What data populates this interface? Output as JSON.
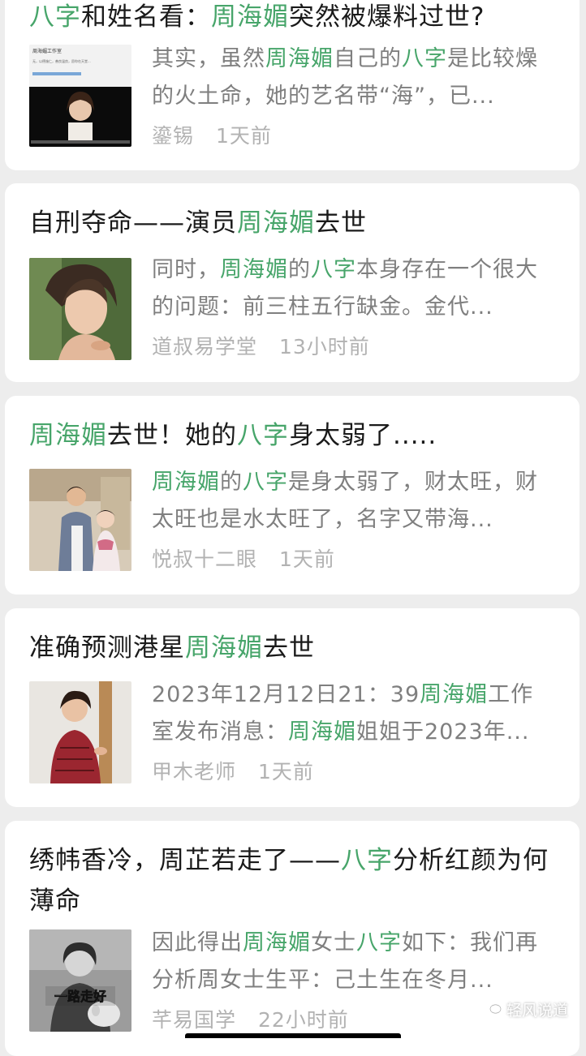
{
  "articles": [
    {
      "title": [
        {
          "t": "八字",
          "hl": true
        },
        {
          "t": "和姓名看：",
          "hl": false
        },
        {
          "t": "周海媚",
          "hl": true
        },
        {
          "t": "突然被爆料过世?",
          "hl": false
        }
      ],
      "snippet": [
        {
          "t": "其实，虽然",
          "hl": false
        },
        {
          "t": "周海媚",
          "hl": true
        },
        {
          "t": "自己的",
          "hl": false
        },
        {
          "t": "八字",
          "hl": true
        },
        {
          "t": "是比较燥的火土命，她的艺名带“海”，已...",
          "hl": false
        }
      ],
      "source": "鎏锡",
      "time": "1天前",
      "thumb": "video-screenshot"
    },
    {
      "title": [
        {
          "t": "自刑夺命——演员",
          "hl": false
        },
        {
          "t": "周海媚",
          "hl": true
        },
        {
          "t": "去世",
          "hl": false
        }
      ],
      "snippet": [
        {
          "t": "同时，",
          "hl": false
        },
        {
          "t": "周海媚",
          "hl": true
        },
        {
          "t": "的",
          "hl": false
        },
        {
          "t": "八字",
          "hl": true
        },
        {
          "t": "本身存在一个很大的问题：前三柱五行缺金。金代...",
          "hl": false
        }
      ],
      "source": "道叔易学堂",
      "time": "13小时前",
      "thumb": "portrait-photo"
    },
    {
      "title": [
        {
          "t": "周海媚",
          "hl": true
        },
        {
          "t": "去世！她的",
          "hl": false
        },
        {
          "t": "八字",
          "hl": true
        },
        {
          "t": "身太弱了.....",
          "hl": false
        }
      ],
      "snippet": [
        {
          "t": "周海媚",
          "hl": true
        },
        {
          "t": "的",
          "hl": false
        },
        {
          "t": "八字",
          "hl": true
        },
        {
          "t": "是身太弱了，财太旺，财太旺也是水太旺了，名字又带海...",
          "hl": false
        }
      ],
      "source": "悦叔十二眼",
      "time": "1天前",
      "thumb": "couple-photo"
    },
    {
      "title": [
        {
          "t": "准确预测港星",
          "hl": false
        },
        {
          "t": "周海媚",
          "hl": true
        },
        {
          "t": "去世",
          "hl": false
        }
      ],
      "snippet": [
        {
          "t": "2023年12月12日21：39",
          "hl": false
        },
        {
          "t": "周海媚",
          "hl": true
        },
        {
          "t": "工作室发布消息：",
          "hl": false
        },
        {
          "t": "周海媚",
          "hl": true
        },
        {
          "t": "姐姐于2023年...",
          "hl": false
        }
      ],
      "source": "甲木老师",
      "time": "1天前",
      "thumb": "red-dress-photo"
    },
    {
      "title": [
        {
          "t": "绣帏香冷，周芷若走了——",
          "hl": false
        },
        {
          "t": "八字",
          "hl": true
        },
        {
          "t": "分析红颜为何薄命",
          "hl": false
        }
      ],
      "snippet": [
        {
          "t": "因此得出",
          "hl": false
        },
        {
          "t": "周海媚",
          "hl": true
        },
        {
          "t": "女士",
          "hl": false
        },
        {
          "t": "八字",
          "hl": true
        },
        {
          "t": "如下：我们再分析周女士生平：己土生在冬月...",
          "hl": false
        }
      ],
      "source": "芊易国学",
      "time": "22小时前",
      "thumb": "bw-dog-photo",
      "thumb_caption": "一路走好"
    }
  ],
  "thumb1_text": {
    "header": "周海媚工作室",
    "line": "无，以德施仁，善良温良，愿你在天堂..."
  },
  "watermark": "轻风说道",
  "colors": {
    "highlight": "#47a56a",
    "meta": "#b2b2b2",
    "snippet": "#7f7f7f"
  }
}
